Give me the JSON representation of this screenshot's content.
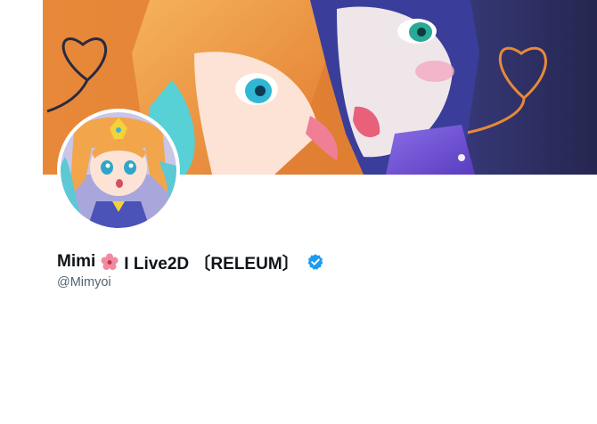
{
  "profile": {
    "name": "Mimi",
    "name_suffix": "I Live2D 〔RELEUM〕",
    "handle": "@Mimyoi",
    "verified": true,
    "name_emoji": "hibiscus-icon"
  },
  "colors": {
    "banner_left": "#e8893a",
    "banner_right": "#27285a",
    "verified": "#1d9bf0",
    "text_primary": "#0f1419",
    "text_secondary": "#536471"
  }
}
